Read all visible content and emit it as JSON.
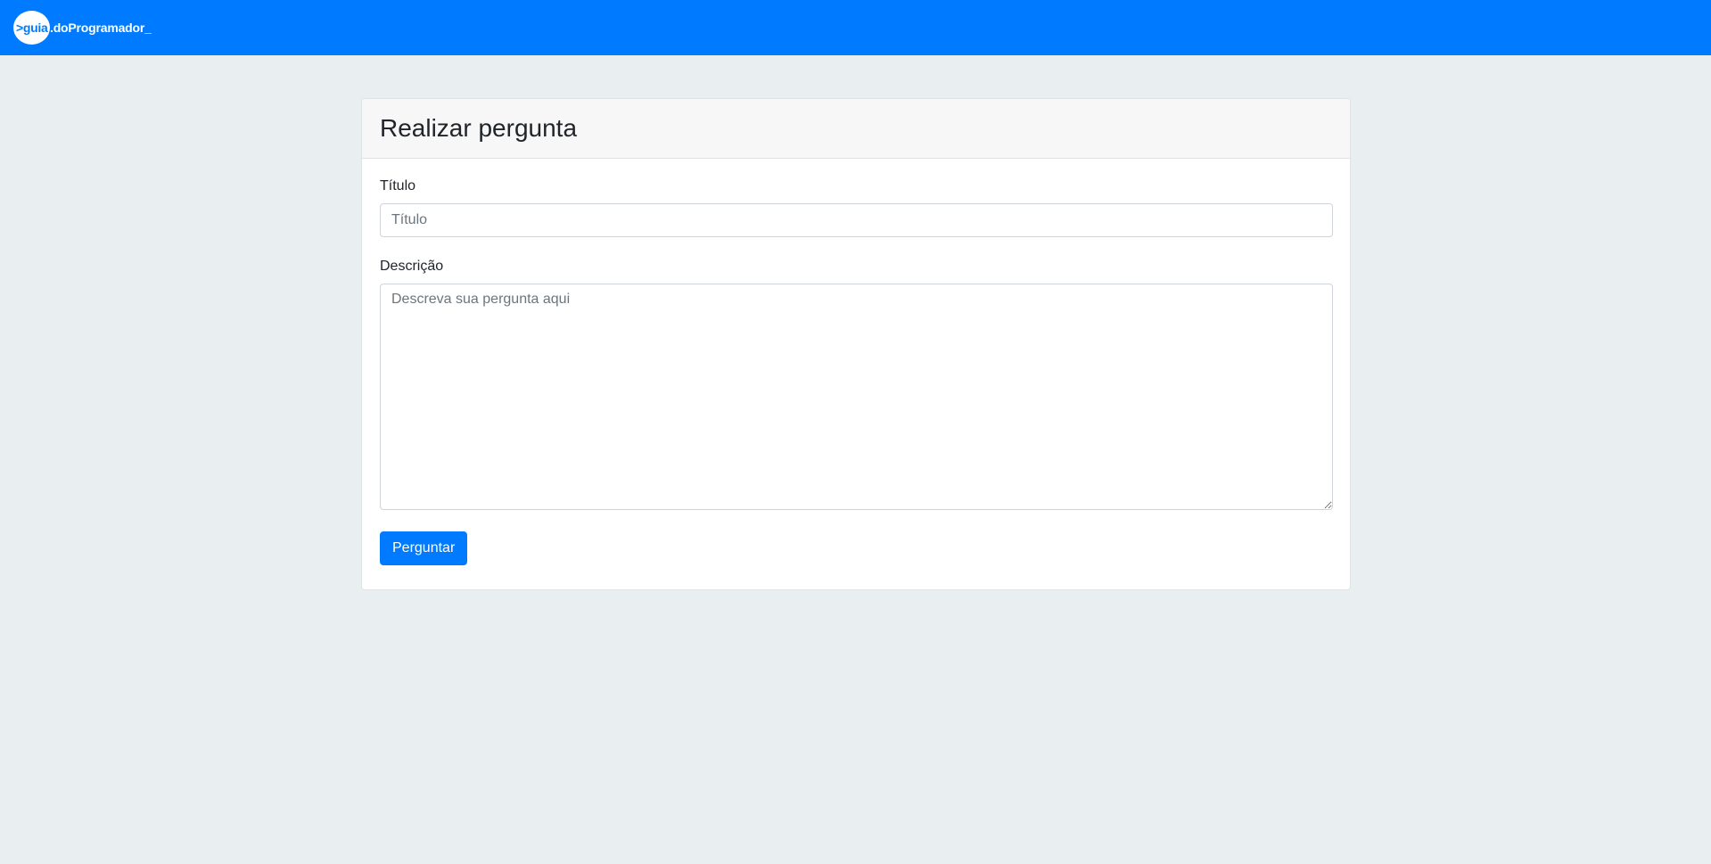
{
  "navbar": {
    "brand_prefix": ">guia",
    "brand_suffix": ".doProgramador",
    "brand_cursor": "_"
  },
  "card": {
    "title": "Realizar pergunta",
    "title_field": {
      "label": "Título",
      "placeholder": "Título",
      "value": ""
    },
    "description_field": {
      "label": "Descrição",
      "placeholder": "Descreva sua pergunta aqui",
      "value": ""
    },
    "submit_label": "Perguntar"
  },
  "colors": {
    "primary": "#007bff",
    "background": "#e9eef1",
    "card_header": "#f7f7f7"
  }
}
